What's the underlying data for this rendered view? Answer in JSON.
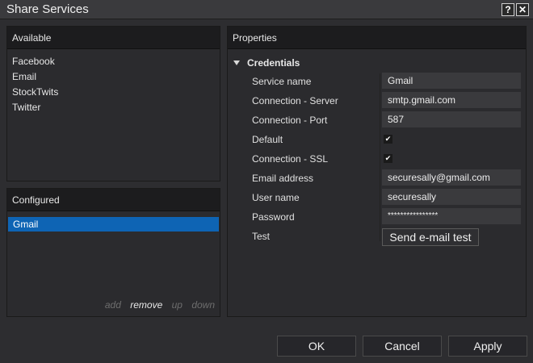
{
  "window": {
    "title": "Share Services",
    "help_label": "?",
    "close_label": "✕"
  },
  "available": {
    "header": "Available",
    "items": [
      "Facebook",
      "Email",
      "StockTwits",
      "Twitter"
    ]
  },
  "configured": {
    "header": "Configured",
    "items": [
      "Gmail"
    ],
    "selected": "Gmail",
    "actions": {
      "add": "add",
      "remove": "remove",
      "up": "up",
      "down": "down"
    }
  },
  "properties": {
    "header": "Properties",
    "section": "Credentials",
    "rows": {
      "service_name": {
        "label": "Service name",
        "value": "Gmail"
      },
      "server": {
        "label": "Connection - Server",
        "value": "smtp.gmail.com"
      },
      "port": {
        "label": "Connection - Port",
        "value": "587"
      },
      "default": {
        "label": "Default",
        "checked": true
      },
      "ssl": {
        "label": "Connection - SSL",
        "checked": true
      },
      "email": {
        "label": "Email address",
        "value": "securesally@gmail.com"
      },
      "username": {
        "label": "User name",
        "value": "securesally"
      },
      "password": {
        "label": "Password",
        "value": "****************"
      },
      "test": {
        "label": "Test",
        "button": "Send e-mail test"
      }
    }
  },
  "footer": {
    "ok": "OK",
    "cancel": "Cancel",
    "apply": "Apply"
  },
  "icons": {
    "check": "✔"
  }
}
